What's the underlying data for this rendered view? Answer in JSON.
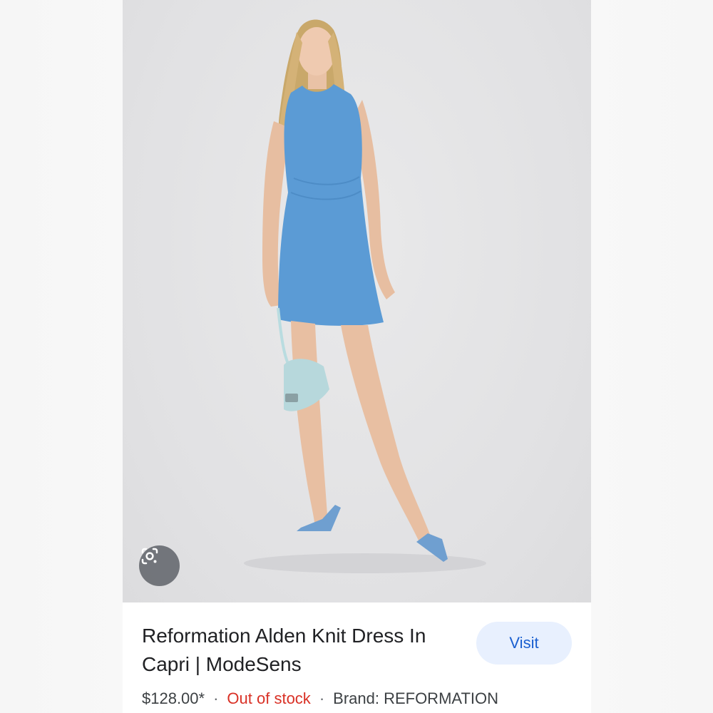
{
  "result": {
    "title": "Reformation Alden Knit Dress In Capri | ModeSens",
    "title_line1": "Reformation Alden Knit Dress In",
    "title_line2": "Capri | ModeSens",
    "visit_label": "Visit",
    "price": "$128.00*",
    "separator": "·",
    "stock_status": "Out of stock",
    "brand": "Brand: REFORMATION"
  },
  "icons": {
    "lens": "google-lens-icon"
  },
  "colors": {
    "dress": "#5b9bd5",
    "stock_red": "#d93025",
    "visit_bg": "#e8f0fe",
    "visit_text": "#1a5fd0"
  }
}
